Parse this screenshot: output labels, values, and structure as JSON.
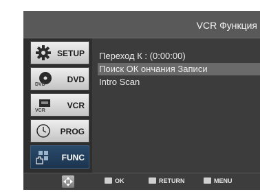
{
  "header": {
    "title": "VCR Функция"
  },
  "sidebar": {
    "tabs": [
      {
        "label": "SETUP",
        "icon": "gear-icon"
      },
      {
        "label": "DVD",
        "icon": "dvd-icon",
        "badge": "DVD"
      },
      {
        "label": "VCR",
        "icon": "vcr-icon",
        "badge": "VCR"
      },
      {
        "label": "PROG",
        "icon": "clock-icon"
      },
      {
        "label": "FUNC",
        "icon": "func-icon"
      }
    ],
    "active_index": 4
  },
  "menu": {
    "items": [
      {
        "label": "Переход К : (0:00:00)"
      },
      {
        "label": "Поиск ОК ончания Записи",
        "selected": true
      },
      {
        "label": "Intro Scan"
      }
    ]
  },
  "footer": {
    "ok_label": "OK",
    "return_label": "RETURN",
    "menu_label": "MENU"
  },
  "colors": {
    "active_tab": "#1b3550",
    "highlight": "#6a6a6a"
  }
}
